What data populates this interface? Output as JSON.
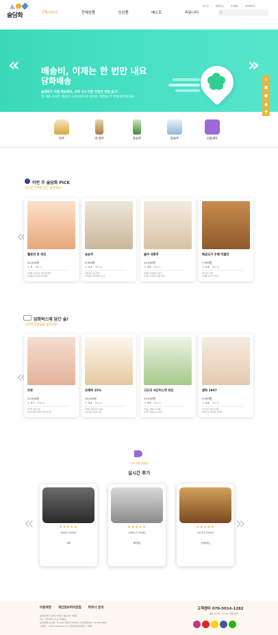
{
  "header": {
    "logo_text": "술담화",
    "nav": [
      "구독서비스",
      "전체상품",
      "신상품",
      "베스트",
      "커뮤니티"
    ],
    "top_links": [
      "로그인",
      "회원가입",
      "고객센터",
      "마이페이지"
    ]
  },
  "hero": {
    "line1": "배송비, 이제는 한 번만 내요",
    "line2": "담화배송",
    "sub1": "술담화가 직접 배송해요, 오후 1시 이전 주문건 당일 출고!",
    "sub2": "몇 개를 고르든 배송비 3,000원으로 원하는 제품을 한 번에 받아보세요.",
    "prev": "«",
    "next": "»"
  },
  "quick_menu": [
    "▲",
    "▼"
  ],
  "categories": [
    "탁주",
    "약·청주",
    "과실주",
    "증류주",
    "선물세트"
  ],
  "pick": {
    "title": "이번 주 술담화 PICK",
    "subtitle": "엄선한 기획을 담은 술이에요!",
    "items": [
      {
        "name": "웰포바 로 와인",
        "price": "22,000원",
        "rating": "5",
        "count": "리뷰 12",
        "d1": "#레몬 #산미강 #화이트와인",
        "d2": "#상큼함 #오렌지 #베리"
      },
      {
        "name": "송송주",
        "price": "9,000원",
        "rating": "4.4",
        "count": "리뷰 28",
        "d1": "#향긋한 #소주향",
        "d2": "#은은함 #갈색빛 #고소"
      },
      {
        "name": "솔아 국화주",
        "price": "11,000원",
        "rating": "4.6",
        "count": "리뷰 31",
        "d1": "#꽃향 #국화차 #보다",
        "d2": "#겨울 #국화 #단맛 #향"
      },
      {
        "name": "배공도가 수제 막걸리",
        "price": "7,500원",
        "rating": "4.6",
        "count": "리뷰 19",
        "d1": "#막걸리 #쌀",
        "d2": "#달콤 #진한 #우유"
      }
    ]
  },
  "box": {
    "title": "담화박스에 담긴 술!",
    "subtitle": "나만의 인생술을 찾았어요?",
    "items": [
      {
        "name": "우뭇",
        "price": "10,000원",
        "rating": "4.7",
        "count": "리뷰 14",
        "d1": "#식물 #술 #맛",
        "d2": "#부드러운 #하얀 #꽃 #선물"
      },
      {
        "name": "오매락 25%",
        "price": "10,000원",
        "rating": "4.4",
        "count": "리뷰 18",
        "d1": "#매실 #진한맛 #선물",
        "d2": "#오크향 #진한 #향"
      },
      {
        "name": "고도리 샤인머스캣 와인",
        "price": "23,000원",
        "rating": "4.6",
        "count": "리뷰 23",
        "d1": "#포도 #와인 #달콤",
        "d2": "#샤인 #청포도 #시원"
      },
      {
        "name": "원탁 1957",
        "price": "3,500원",
        "rating": "4.6",
        "count": "리뷰 21",
        "d1": "#막걸리 #쌀 #전통",
        "d2": "#부드럽 #목넘김 #깔끔"
      }
    ]
  },
  "reviews": {
    "tag": "\"너의 이름 술술술\"",
    "title": "실시간 후기",
    "items": [
      {
        "stars": "★★★★★",
        "text": "달달함이 적당해요",
        "product": "이제"
      },
      {
        "stars": "★★★★★",
        "text": "선물용으로 딱이에요",
        "product": "제주양조"
      },
      {
        "stars": "★★★★★",
        "text": "향이 좋고 맛있어요",
        "product": "오미자무드"
      }
    ]
  },
  "footer": {
    "links": [
      "이용약관",
      "개인정보처리방침",
      "파트너 문의"
    ],
    "info": [
      "농업회사법인 술담화 주식회사 대표자명 : 이재욱",
      "주소 : 서울특별시 강남구 테헤란로",
      "통신판매업신고번호 : 제 2018-서울강남-0000호 | 사업자등록번호 : 000-00-00000",
      "고객상담 : cs@sooldamhwa.com | 개인정보보호책임자 : 이재욱"
    ],
    "cs_label": "고객센터 070-5014-1282",
    "cs_hours": "평일 10:00 - 17:00 / 주말 휴무"
  },
  "colors": {
    "accent": "#f39c2e",
    "hero": "#3ad9b8",
    "star": "#f5a623"
  }
}
